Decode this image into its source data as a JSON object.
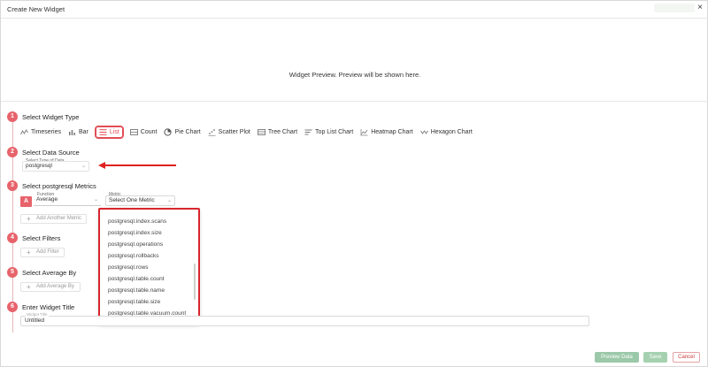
{
  "modal": {
    "title": "Create New Widget",
    "close_label": "×"
  },
  "preview": {
    "text": "Widget Preview. Preview will be shown here."
  },
  "steps": [
    {
      "number": "1",
      "title": "Select Widget Type"
    },
    {
      "number": "2",
      "title": "Select Data Source"
    },
    {
      "number": "3",
      "title": "Select postgresql Metrics"
    },
    {
      "number": "4",
      "title": "Select Filters"
    },
    {
      "number": "5",
      "title": "Select Average By"
    },
    {
      "number": "6",
      "title": "Enter Widget Title"
    }
  ],
  "widget_types": [
    {
      "label": "Timeseries",
      "icon": "timeseries-icon",
      "active": false
    },
    {
      "label": "Bar",
      "icon": "bar-chart-icon",
      "active": false
    },
    {
      "label": "List",
      "icon": "list-icon",
      "active": true
    },
    {
      "label": "Count",
      "icon": "count-icon",
      "active": false
    },
    {
      "label": "Pie Chart",
      "icon": "pie-chart-icon",
      "active": false
    },
    {
      "label": "Scatter Plot",
      "icon": "scatter-plot-icon",
      "active": false
    },
    {
      "label": "Tree Chart",
      "icon": "tree-chart-icon",
      "active": false
    },
    {
      "label": "Top List Chart",
      "icon": "top-list-chart-icon",
      "active": false
    },
    {
      "label": "Heatmap Chart",
      "icon": "heatmap-chart-icon",
      "active": false
    },
    {
      "label": "Hexagon Chart",
      "icon": "hexagon-chart-icon",
      "active": false
    }
  ],
  "data_source": {
    "label": "Select Type of Data",
    "value": "postgresql"
  },
  "metrics": {
    "aggregate_badge": "A",
    "function_label": "Function",
    "function_value": "Average",
    "metric_label": "Metric",
    "metric_placeholder": "Select One Metric",
    "add_metric_label": "Add Another Metric"
  },
  "metric_options": [
    "postgresql.index.scans",
    "postgresql.index.size",
    "postgresql.operations",
    "postgresql.rollbacks",
    "postgresql.rows",
    "postgresql.table.count",
    "postgresql.table.name",
    "postgresql.table.size",
    "postgresql.table.vacuum.count"
  ],
  "filters": {
    "add_label": "Add Filter"
  },
  "average_by": {
    "add_label": "Add Average By"
  },
  "widget_title": {
    "label": "Widget Title",
    "value": "Untitled"
  },
  "footer": {
    "preview_label": "Preview Data",
    "save_label": "Save",
    "cancel_label": "Cancel"
  },
  "colors": {
    "accent": "#e7636b",
    "annotation_red": "#e02020",
    "preview_btn": "#9bc8a8",
    "save_btn": "#a5d1b0"
  }
}
